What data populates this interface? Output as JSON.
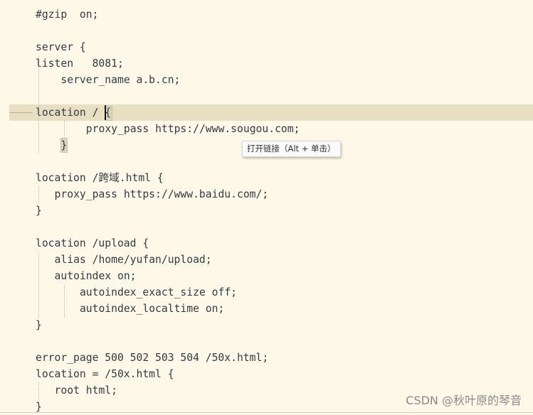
{
  "editor": {
    "lines": [
      {
        "indent": 0,
        "text": "#gzip  on;"
      },
      {
        "indent": 0,
        "text": "server {"
      },
      {
        "indent": 0,
        "text": "listen   8081;"
      },
      {
        "indent": 4,
        "text": "server_name a.b.cn;"
      },
      {
        "indent": 0,
        "text": "location / {"
      },
      {
        "indent": 8,
        "text": "proxy_pass https://www.sougou.com;"
      },
      {
        "indent": 4,
        "text": "}"
      },
      {
        "indent": 0,
        "text": "location /跨域.html {"
      },
      {
        "indent": 3,
        "text": "proxy_pass https://www.baidu.com/;"
      },
      {
        "indent": 0,
        "text": "}"
      },
      {
        "indent": 0,
        "text": "location /upload {"
      },
      {
        "indent": 3,
        "text": "alias /home/yufan/upload;"
      },
      {
        "indent": 3,
        "text": "autoindex on;"
      },
      {
        "indent": 7,
        "text": "autoindex_exact_size off;"
      },
      {
        "indent": 7,
        "text": "autoindex_localtime on;"
      },
      {
        "indent": 0,
        "text": "}"
      },
      {
        "indent": 0,
        "text": "error_page 500 502 503 504 /50x.html;"
      },
      {
        "indent": 0,
        "text": "location = /50x.html {"
      },
      {
        "indent": 3,
        "text": "root html;"
      },
      {
        "indent": 0,
        "text": "}"
      }
    ],
    "line_rows": [
      0,
      2,
      3,
      4,
      6,
      7,
      8,
      10,
      11,
      12,
      14,
      15,
      16,
      17,
      18,
      19,
      21,
      22,
      23,
      24
    ],
    "highlighted_line": 4
  },
  "tooltip": {
    "text": "打开链接（Alt + 单击）"
  },
  "watermark": {
    "text": "CSDN @秋叶原的琴音"
  },
  "colors": {
    "background": "#fdf8e7",
    "current_line": "#e8dfc3",
    "text": "#333b45"
  }
}
